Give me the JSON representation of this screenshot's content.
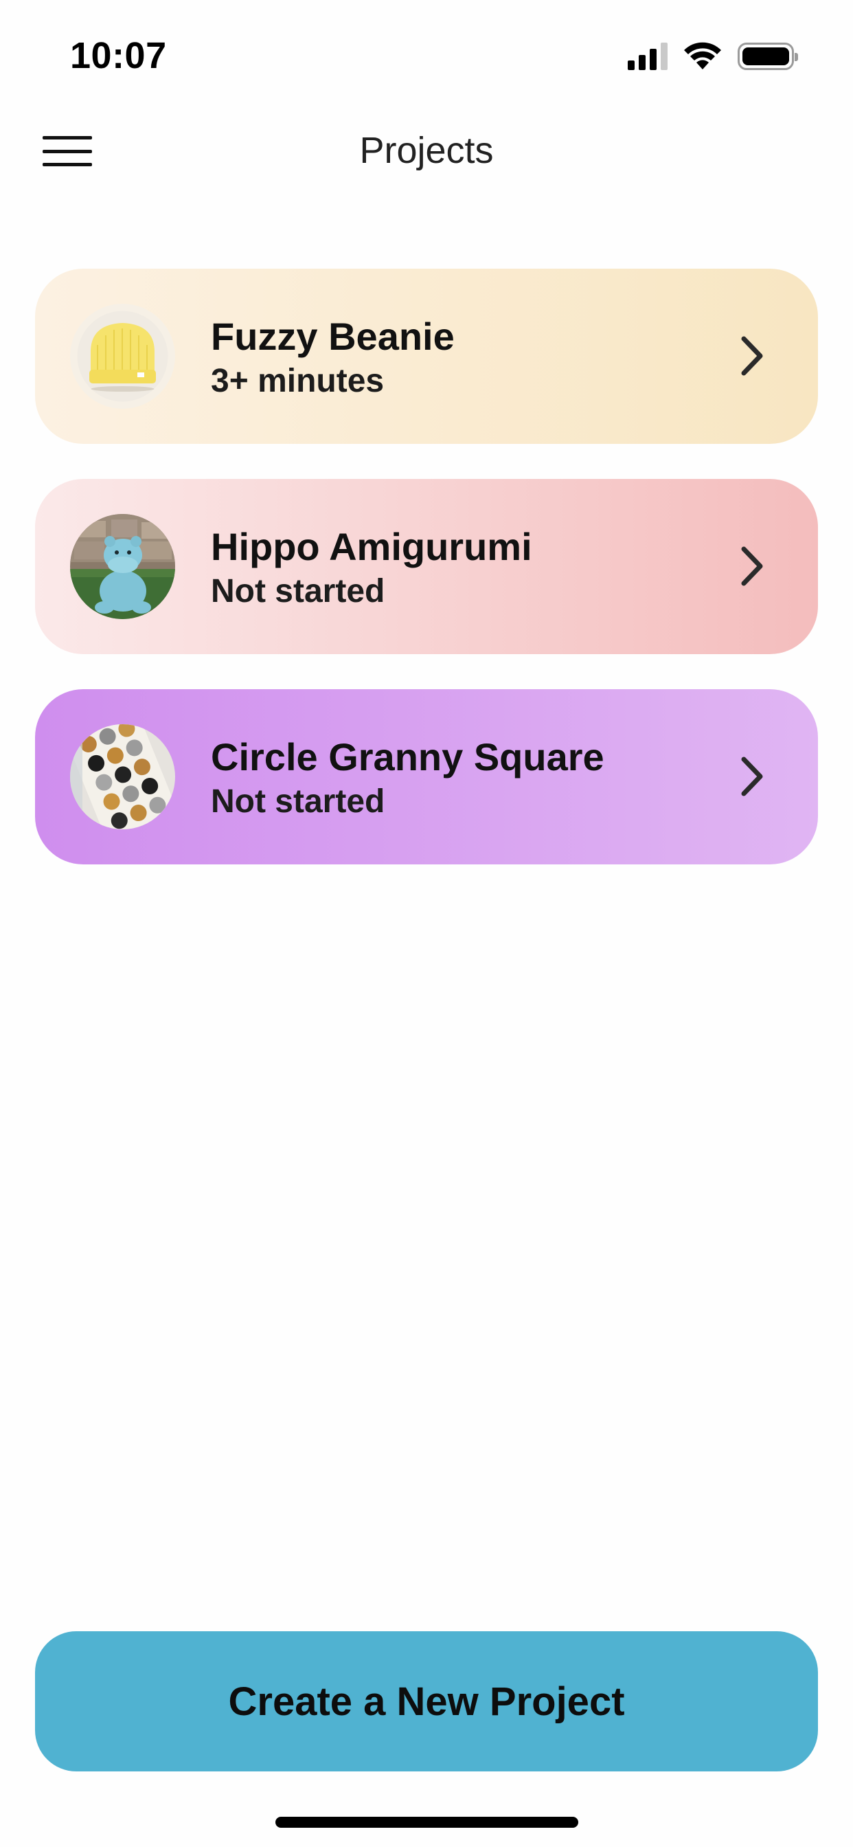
{
  "status_bar": {
    "time": "10:07",
    "icons": [
      "cellular-signal-icon",
      "wifi-icon",
      "battery-icon"
    ]
  },
  "nav": {
    "title": "Projects",
    "menu_icon": "hamburger-menu-icon"
  },
  "projects": [
    {
      "title": "Fuzzy Beanie",
      "subtitle": "3+ minutes",
      "thumbnail": "yellow knitted beanie photo",
      "gradient": [
        "#fcf1e2",
        "#f8e6c2"
      ]
    },
    {
      "title": "Hippo Amigurumi",
      "subtitle": "Not started",
      "thumbnail": "blue crochet hippo photo",
      "gradient": [
        "#fbe9e9",
        "#f4bdbd"
      ]
    },
    {
      "title": "Circle Granny Square",
      "subtitle": "Not started",
      "thumbnail": "granny square blanket photo",
      "gradient": [
        "#cf8eee",
        "#e0b5f3"
      ]
    }
  ],
  "cta": {
    "label": "Create a New Project",
    "color": "#50b2d1"
  }
}
